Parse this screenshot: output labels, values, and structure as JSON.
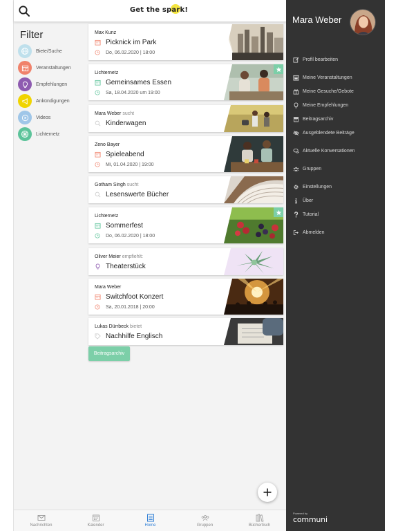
{
  "header": {
    "brand": "Get the spark!"
  },
  "filter": {
    "title": "Filter",
    "items": [
      {
        "label": "Biete/Suche",
        "color": "#bfe0ec",
        "icon": "globe-icon"
      },
      {
        "label": "Veranstaltungen",
        "color": "#f0826b",
        "icon": "calendar-icon"
      },
      {
        "label": "Empfehlungen",
        "color": "#8e5bb0",
        "icon": "lightbulb-icon"
      },
      {
        "label": "Ankündigungen",
        "color": "#f0d400",
        "icon": "announcement-icon"
      },
      {
        "label": "Videos",
        "color": "#9fc6e8",
        "icon": "play-icon"
      },
      {
        "label": "Lichternetz",
        "color": "#5cc39a",
        "icon": "network-icon"
      }
    ]
  },
  "feed": {
    "cards": [
      {
        "author": "Max Kunz",
        "verb": "",
        "title": "Picknick im Park",
        "date": "Do, 06.02.2020 | 18:00",
        "kind": "event",
        "image": "city-skyline",
        "starred": false
      },
      {
        "author": "Lichternetz",
        "verb": "",
        "title": "Gemeinsames Essen",
        "date": "Sa, 18.04.2020 um 19:00",
        "kind": "event-green",
        "image": "friends-dining",
        "starred": true
      },
      {
        "author": "Mara Weber",
        "verb": "sucht",
        "title": "Kinderwagen",
        "date": "",
        "kind": "search",
        "image": "family-walk",
        "starred": false
      },
      {
        "author": "Zeno Bayer",
        "verb": "",
        "title": "Spieleabend",
        "date": "Mi, 01.04.2020 | 19:00",
        "kind": "event",
        "image": "board-game",
        "starred": false
      },
      {
        "author": "Gotham Singh",
        "verb": "sucht",
        "title": "Lesenswerte Bücher",
        "date": "",
        "kind": "search",
        "image": "open-book",
        "starred": false
      },
      {
        "author": "Lichternetz",
        "verb": "",
        "title": "Sommerfest",
        "date": "Do, 06.02.2020 | 18:00",
        "kind": "event-green",
        "image": "berries",
        "starred": true
      },
      {
        "author": "Oliver Meier",
        "verb": "empfiehlt:",
        "title": "Theaterstück",
        "date": "",
        "kind": "recommend",
        "image": "succulent",
        "starred": false
      },
      {
        "author": "Mara Weber",
        "verb": "",
        "title": "Switchfoot Konzert",
        "date": "Sa, 20.01.2018 | 20:00",
        "kind": "event",
        "image": "concert",
        "starred": false
      },
      {
        "author": "Lukas Dürrbeck",
        "verb": "bietet",
        "title": "Nachhilfe Englisch",
        "date": "",
        "kind": "offer",
        "image": "writing",
        "starred": false
      }
    ],
    "archive_label": "Beitragsarchiv"
  },
  "bottom_nav": [
    {
      "label": "Nachrichten",
      "icon": "mail-icon",
      "active": false
    },
    {
      "label": "Kalender",
      "icon": "calendar-icon",
      "active": false
    },
    {
      "label": "Home",
      "icon": "home-list-icon",
      "active": true
    },
    {
      "label": "Gruppen",
      "icon": "group-icon",
      "active": false
    },
    {
      "label": "Büchertisch",
      "icon": "books-icon",
      "active": false
    }
  ],
  "side_menu": {
    "user_name": "Mara Weber",
    "items": [
      {
        "label": "Profil bearbeiten",
        "icon": "edit-icon"
      },
      {
        "label": "Meine Veranstaltungen",
        "icon": "calendar-icon"
      },
      {
        "label": "Meine Gesuche/Gebote",
        "icon": "gift-icon"
      },
      {
        "label": "Meine Empfehlungen",
        "icon": "lightbulb-icon"
      },
      {
        "label": "Beitragsarchiv",
        "icon": "archive-icon"
      },
      {
        "label": "Ausgeblendete Beiträge",
        "icon": "eye-slash-icon"
      },
      {
        "label": "Aktuelle Konversationen",
        "icon": "chat-icon"
      },
      {
        "label": "Gruppen",
        "icon": "group-icon"
      },
      {
        "label": "Einstellungen",
        "icon": "gear-icon"
      },
      {
        "label": "Über",
        "icon": "info-icon"
      },
      {
        "label": "Tutorial",
        "icon": "question-icon"
      },
      {
        "label": "Abmelden",
        "icon": "logout-icon"
      }
    ],
    "powered_by": "Powered by",
    "logo": "communi"
  },
  "colors": {
    "accent_green": "#7ccfa8",
    "event_red": "#f0826b",
    "active_blue": "#2f7fd6",
    "menu_bg": "#333333"
  }
}
